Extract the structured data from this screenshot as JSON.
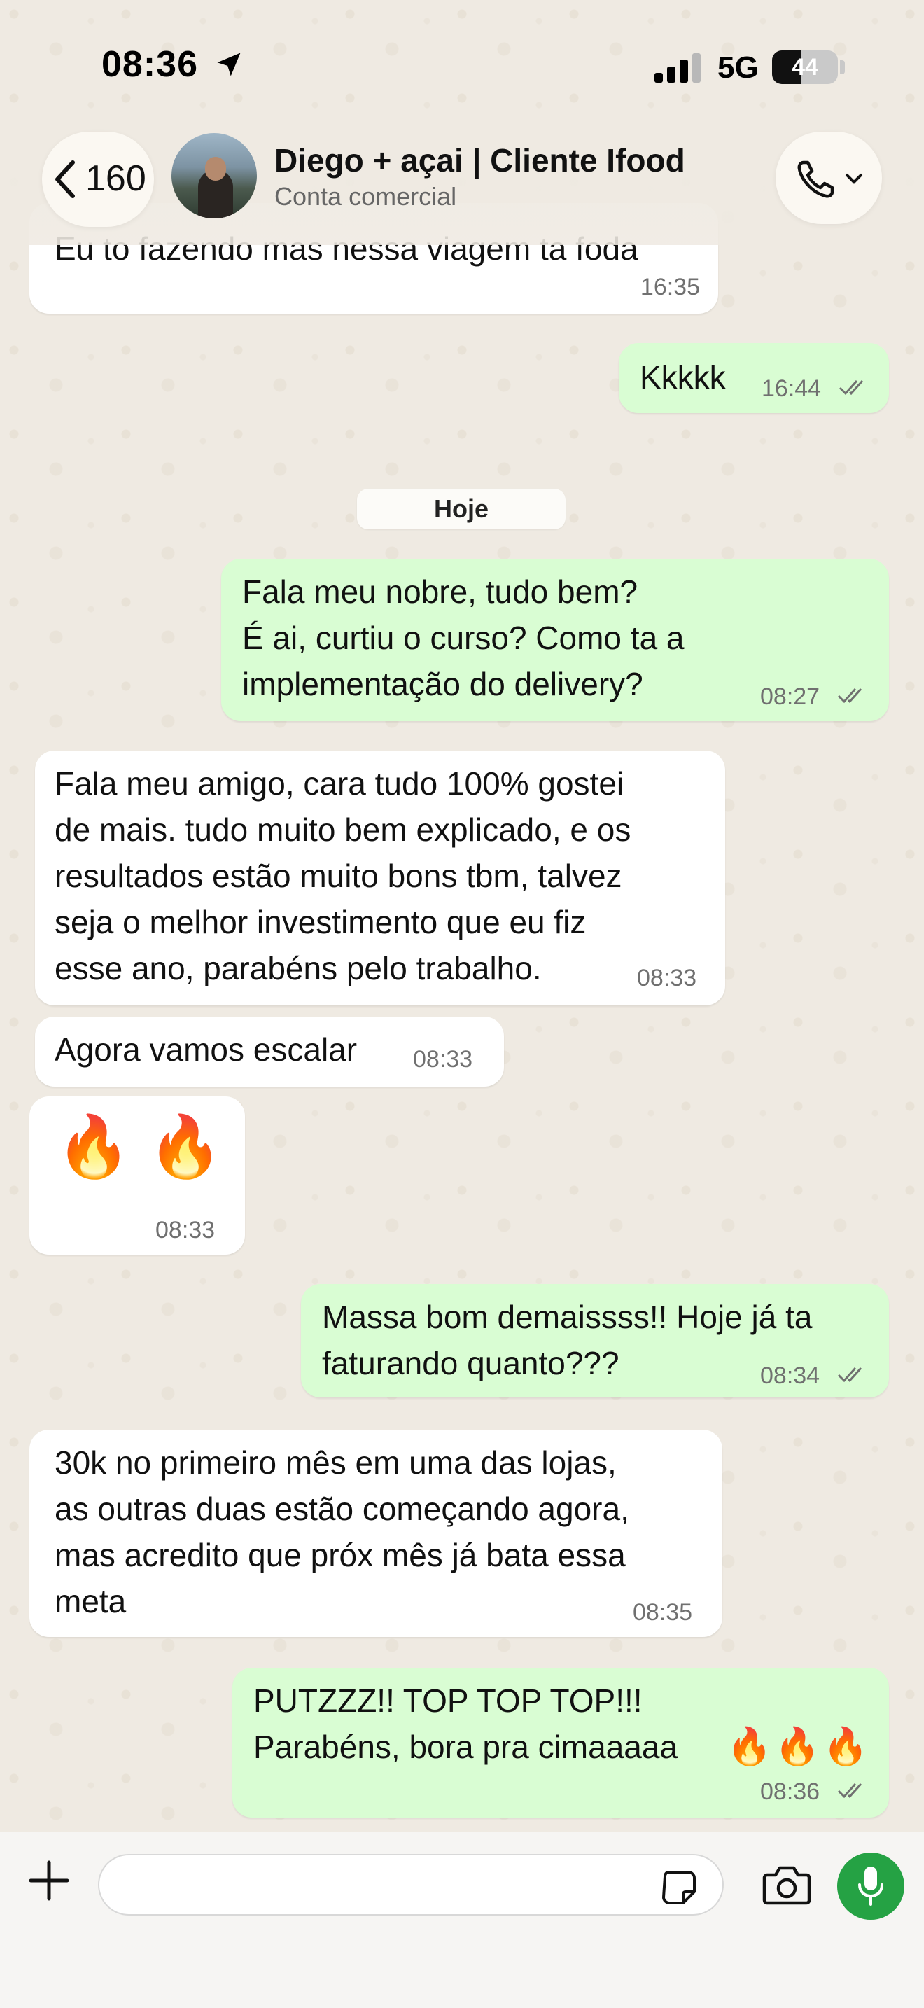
{
  "status_bar": {
    "time": "08:36",
    "network": "5G",
    "battery": "44",
    "battery_level": 0.44
  },
  "header": {
    "back_count": "160",
    "contact_name": "Diego + açai | Cliente Ifood",
    "contact_subtitle": "Conta comercial"
  },
  "messages": [
    {
      "direction": "in",
      "text": "Eu to fazendo mas nessa viagem ta foda",
      "time": "16:35"
    },
    {
      "direction": "out",
      "text": "Kkkkk",
      "time": "16:44",
      "status": "read"
    },
    {
      "direction": "out",
      "text": "Fala meu nobre, tudo bem?\nÉ ai, curtiu o curso? Como ta a\nimplementação do delivery?",
      "time": "08:27",
      "status": "read"
    },
    {
      "direction": "in",
      "text": "Fala meu amigo, cara tudo 100% gostei\nde mais. tudo muito bem explicado, e os\nresultados estão muito bons tbm, talvez\nseja o melhor investimento que eu fiz\nesse ano, parabéns pelo trabalho.",
      "time": "08:33"
    },
    {
      "direction": "in",
      "text": "Agora vamos escalar",
      "time": "08:33"
    },
    {
      "direction": "in",
      "text": "🔥 🔥",
      "time": "08:33"
    },
    {
      "direction": "out",
      "text": "Massa bom demaissss!! Hoje já ta\nfaturando quanto???",
      "time": "08:34",
      "status": "read"
    },
    {
      "direction": "in",
      "text": "30k no primeiro mês em uma das lojas,\nas outras duas estão começando agora,\nmas acredito que próx mês já bata essa\nmeta",
      "time": "08:35"
    },
    {
      "direction": "out",
      "text": "PUTZZZ!! TOP TOP TOP!!!\nParabéns, bora pra cimaaaaa",
      "emoji_suffix": "🔥🔥🔥",
      "time": "08:36",
      "status": "read"
    }
  ],
  "date_separator": "Hoje",
  "input": {
    "placeholder": "",
    "value": ""
  },
  "colors": {
    "incoming_bubble": "#ffffff",
    "outgoing_bubble": "#d9fdd3",
    "mic_button": "#25a244",
    "background": "#efeae2"
  },
  "icons": [
    "location-arrow-icon",
    "signal-icon",
    "battery-icon",
    "back-chevron-icon",
    "phone-icon",
    "chevron-down-icon",
    "plus-icon",
    "sticker-icon",
    "camera-icon",
    "mic-icon",
    "read-ticks-icon"
  ]
}
